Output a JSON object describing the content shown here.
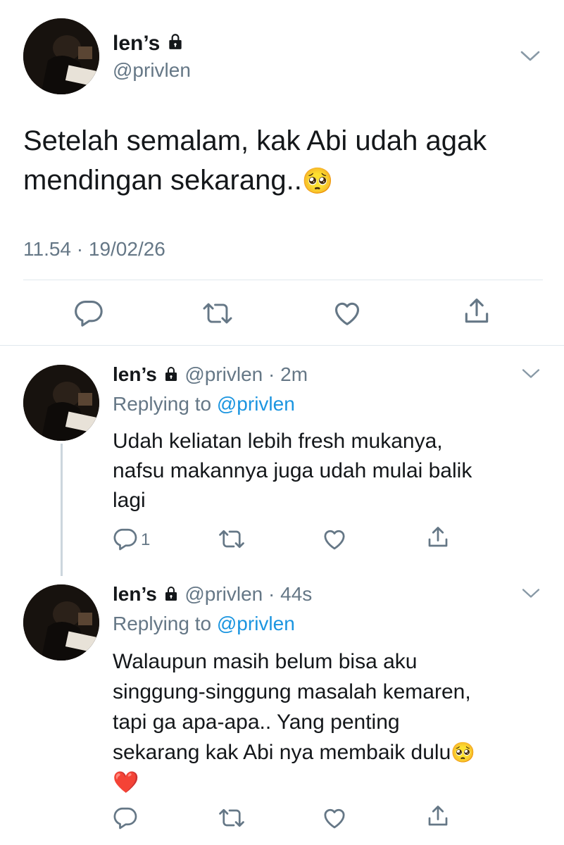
{
  "main_tweet": {
    "display_name": "len’s",
    "handle": "@privlen",
    "text_line1": "Setelah semalam, kak Abi udah agak",
    "text_line2": "mendingan sekarang..",
    "emoji": "🥺",
    "timestamp": "11.54 · 19/02/26"
  },
  "replies": [
    {
      "display_name": "len’s",
      "handle_time": "@privlen · 2m",
      "replying_prefix": "Replying to ",
      "replying_handle": "@privlen",
      "lines": [
        "Udah keliatan lebih fresh mukanya,",
        "nafsu makannya juga udah mulai balik",
        "lagi"
      ],
      "reply_count": "1"
    },
    {
      "display_name": "len’s",
      "handle_time": "@privlen · 44s",
      "replying_prefix": "Replying to ",
      "replying_handle": "@privlen",
      "lines": [
        "Walaupun masih belum bisa aku",
        "singgung-singgung masalah kemaren,",
        "tapi ga apa-apa.. Yang penting",
        "sekarang kak Abi nya membaik dulu"
      ],
      "emoji_inline": "🥺",
      "emoji_line": "❤️",
      "reply_count": ""
    }
  ],
  "colors": {
    "text": "#14171a",
    "secondary": "#657786",
    "link": "#1b95e0",
    "divider": "#e1e8ed",
    "icon": "#657786"
  }
}
